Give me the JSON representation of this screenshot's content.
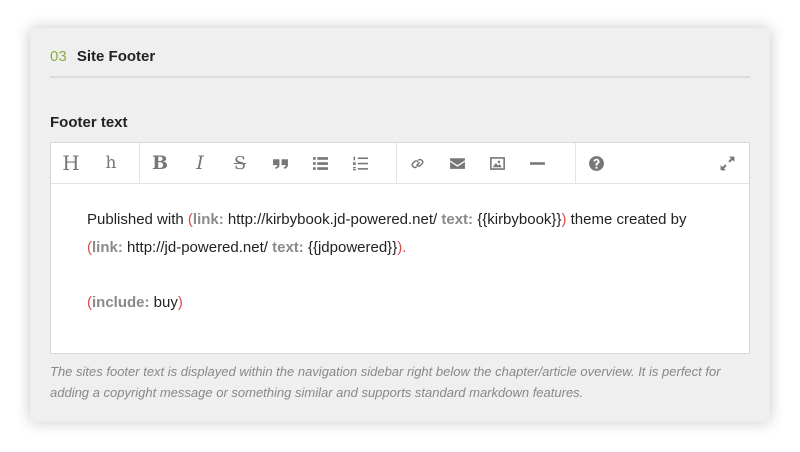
{
  "section": {
    "number": "03",
    "title": "Site Footer"
  },
  "field": {
    "label": "Footer text"
  },
  "toolbar": {
    "h1_label": "H",
    "h2_label": "h",
    "bold_label": "B",
    "italic_label": "I",
    "strike_label": "S"
  },
  "content": {
    "line1": {
      "t1": "Published with ",
      "kw1": "link:",
      "t2": " http://kirbybook.jd-powered.net/ ",
      "kw2": "text:",
      "t3": " {{kirbybook}}",
      "t4": " theme created by "
    },
    "line2": {
      "kw1": "link:",
      "t2": " http://jd-powered.net/ ",
      "kw2": "text:",
      "t3": " {{jdpowered}}",
      "t4": "."
    },
    "line3": {
      "kw1": "include:",
      "t2": " buy"
    },
    "open_paren": "(",
    "close_paren": ")"
  },
  "hint": "The sites footer text is displayed within the navigation sidebar right below the chapter/article overview. It is perfect for adding a copyright message or something similar and supports standard markdown features.",
  "colors": {
    "accent": "#8daa3f",
    "paren": "#e04a4a",
    "keyword": "#8a8a8a"
  }
}
